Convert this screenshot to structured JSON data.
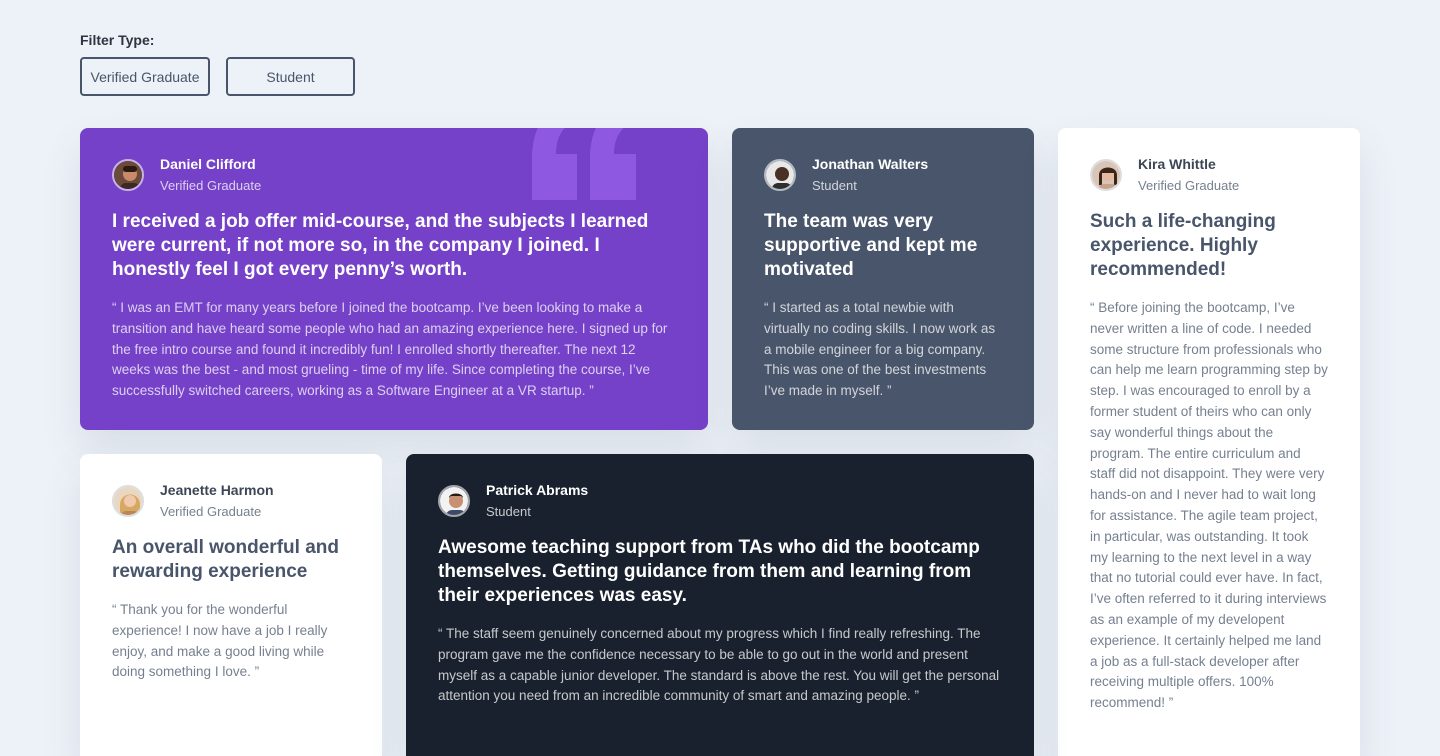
{
  "filter": {
    "label": "Filter Type:",
    "options": [
      "Verified Graduate",
      "Student"
    ]
  },
  "testimonials": [
    {
      "name": "Daniel Clifford",
      "role": "Verified Graduate",
      "headline": "I received a job offer mid-course, and the subjects I learned were current, if not more so, in the company I joined. I honestly feel I got every penny’s worth.",
      "quote": "“ I was an EMT for many years before I joined the bootcamp. I’ve been looking to make a transition and have heard some people who had an amazing experience here. I signed up for the free intro course and found it incredibly fun! I enrolled shortly thereafter. The next 12 weeks was the best - and most grueling - time of my life. Since completing the course, I’ve successfully switched careers, working as a Software Engineer at a VR startup. ”",
      "color": "#7541c8"
    },
    {
      "name": "Jonathan Walters",
      "role": "Student",
      "headline": "The team was very supportive and kept me motivated",
      "quote": "“ I started as a total newbie with virtually no coding skills. I now work as a mobile engineer for a big company. This was one of the best investments I’ve made in myself. ”",
      "color": "#48556a"
    },
    {
      "name": "Kira Whittle",
      "role": "Verified Graduate",
      "headline": "Such a life-changing experience. Highly recommended!",
      "quote": "“ Before joining the bootcamp, I’ve never written a line of code. I needed some structure from professionals who can help me learn programming step by step. I was encouraged to enroll by a former student of theirs who can only say wonderful things about the program. The entire curriculum and staff did not disappoint. They were very hands-on and I never had to wait long for assistance. The agile team project, in particular, was outstanding. It took my learning to the next level in a way that no tutorial could ever have. In fact, I’ve often referred to it during interviews as an example of my developent experience. It certainly helped me land a job as a full-stack developer after receiving multiple offers. 100% recommend! ”",
      "color": "#ffffff"
    },
    {
      "name": "Jeanette Harmon",
      "role": "Verified Graduate",
      "headline": "An overall wonderful and rewarding experience",
      "quote": "“ Thank you for the wonderful experience! I now have a job I really enjoy, and make a good living while doing something I love. ”",
      "color": "#ffffff"
    },
    {
      "name": "Patrick Abrams",
      "role": "Student",
      "headline": "Awesome teaching support from TAs who did the bootcamp themselves. Getting guidance from them and learning from their experiences was easy.",
      "quote": "“ The staff seem genuinely concerned about my progress which I find really refreshing. The program gave me the confidence necessary to be able to go out in the world and present myself as a capable junior developer. The standard is above the rest. You will get the personal attention you need from an incredible community of smart and amazing people. ”",
      "color": "#19212e"
    }
  ]
}
